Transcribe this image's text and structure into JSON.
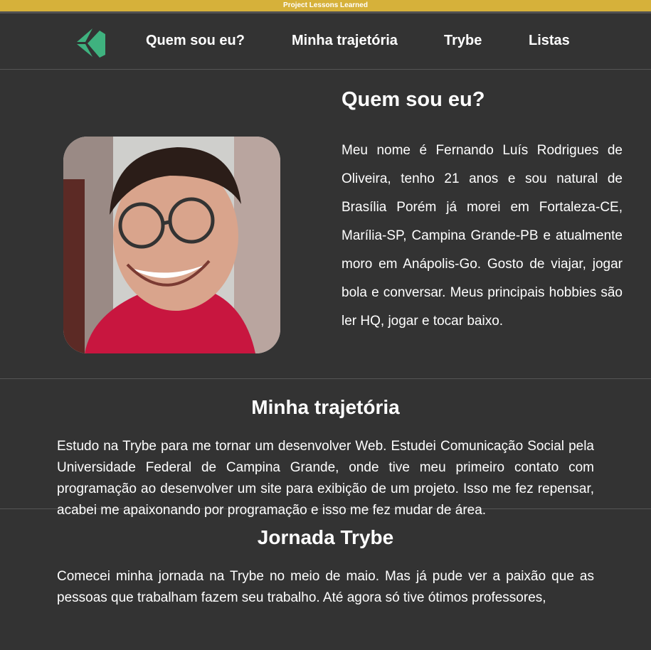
{
  "banner": {
    "text": "Project Lessons Learned"
  },
  "nav": {
    "items": [
      {
        "label": "Quem sou eu?"
      },
      {
        "label": "Minha trajetória"
      },
      {
        "label": "Trybe"
      },
      {
        "label": "Listas"
      }
    ]
  },
  "about": {
    "title": "Quem sou eu?",
    "text": "Meu nome é Fernando Luís Rodrigues de Oliveira, tenho 21 anos e sou natural de Brasília Porém já morei em Fortaleza-CE, Marília-SP, Campina Grande-PB e atualmente moro em Anápolis-Go. Gosto de viajar, jogar bola e conversar. Meus principais hobbies são ler HQ, jogar e tocar baixo."
  },
  "trajectory": {
    "title": "Minha trajetória",
    "text": "Estudo na Trybe para me tornar um desenvolver Web. Estudei Comunicação Social pela Universidade Federal de Campina Grande, onde tive meu primeiro contato com programação ao desenvolver um site para exibição de um projeto. Isso me fez repensar, acabei me apaixonando por programação e isso me fez mudar de área."
  },
  "journey": {
    "title": "Jornada Trybe",
    "text": "Comecei minha jornada na Trybe no meio de maio. Mas já pude ver a paixão que as pessoas que trabalham fazem seu trabalho. Até agora só tive ótimos professores,"
  },
  "colors": {
    "banner": "#d6b13a",
    "background": "#333333",
    "logo": "#3fb27f"
  }
}
